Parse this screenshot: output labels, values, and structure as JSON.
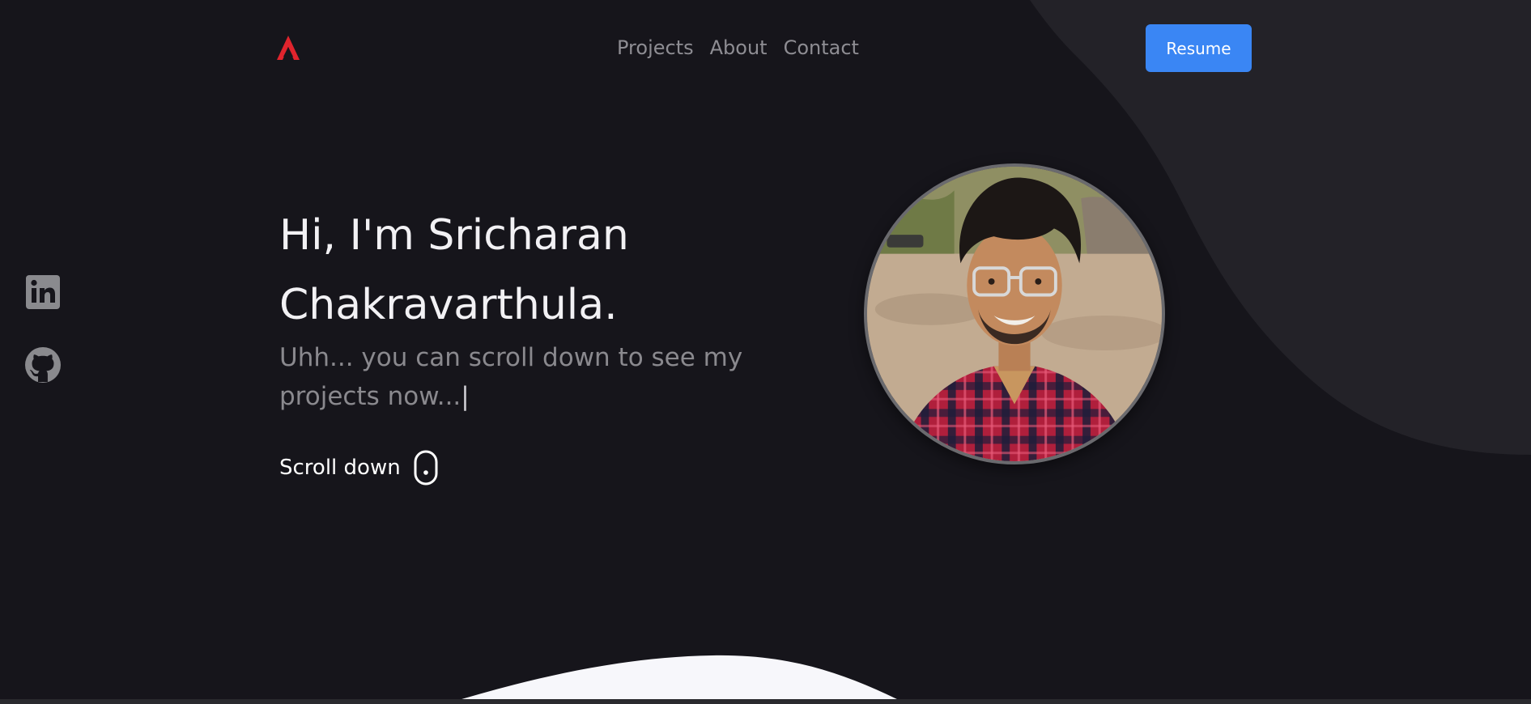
{
  "nav": {
    "items": [
      {
        "label": "Projects"
      },
      {
        "label": "About"
      },
      {
        "label": "Contact"
      }
    ],
    "resume_label": "Resume"
  },
  "hero": {
    "headline_line1": "Hi, I'm Sricharan",
    "headline_line2": "Chakravarthula.",
    "subline": "Uhh... you can scroll down to see my projects now...",
    "cursor": "|",
    "scroll_label": "Scroll down"
  },
  "social": {
    "icons": [
      "linkedin-icon",
      "github-icon"
    ]
  },
  "colors": {
    "background": "#16151b",
    "accent_shape": "#232228",
    "brand_red": "#e0242d",
    "button_blue": "#3a86f4",
    "bottom_wave": "#f7f7fb"
  }
}
